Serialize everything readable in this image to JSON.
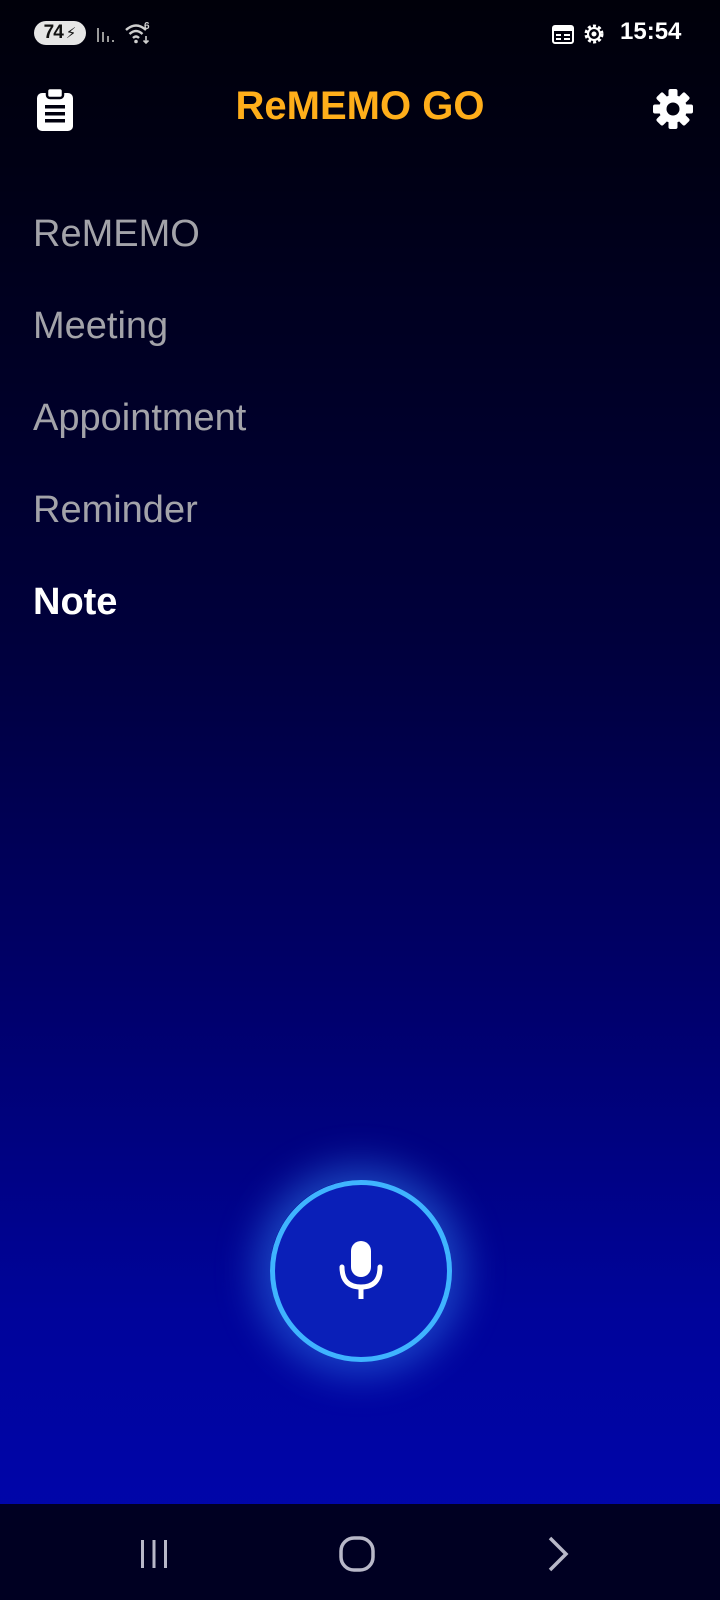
{
  "status_bar": {
    "battery": "74",
    "wifi_badge": "6",
    "time": "15:54"
  },
  "header": {
    "title": "ReMEMO GO",
    "left_icon": "clipboard-icon",
    "right_icon": "gear-icon",
    "title_color": "#ffae1a"
  },
  "menu": {
    "items": [
      {
        "label": "ReMEMO"
      },
      {
        "label": "Meeting"
      },
      {
        "label": "Appointment"
      },
      {
        "label": "Reminder"
      },
      {
        "label": "Note"
      }
    ],
    "active_label": "Note"
  },
  "mic": {
    "icon": "microphone-icon",
    "ring_color": "#3fb4ff"
  },
  "nav_bar": {
    "icons": [
      "recent-apps-icon",
      "home-icon",
      "back-icon"
    ]
  }
}
